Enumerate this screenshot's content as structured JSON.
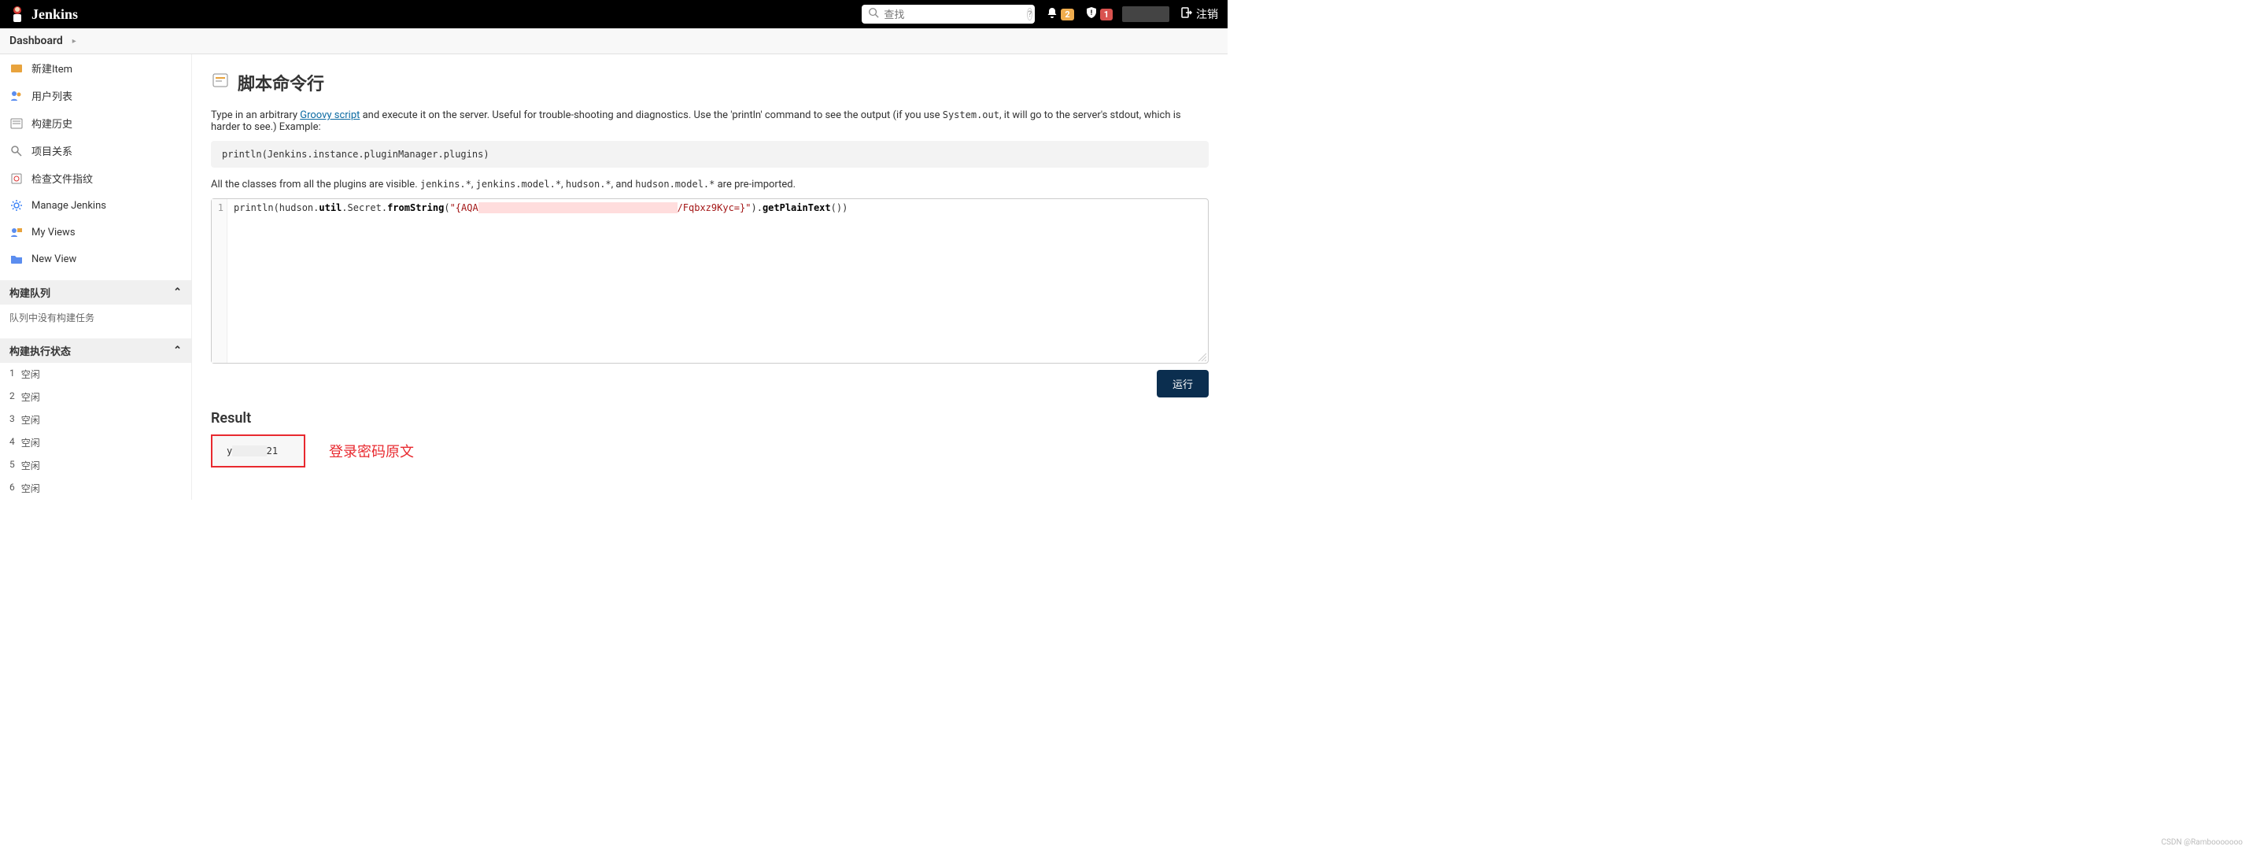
{
  "header": {
    "brand": "Jenkins",
    "search_placeholder": "查找",
    "notif_count": "2",
    "alert_count": "1",
    "logout_label": "注销"
  },
  "breadcrumb": {
    "root": "Dashboard"
  },
  "sidebar": {
    "items": [
      {
        "label": "新建Item"
      },
      {
        "label": "用户列表"
      },
      {
        "label": "构建历史"
      },
      {
        "label": "项目关系"
      },
      {
        "label": "检查文件指纹"
      },
      {
        "label": "Manage Jenkins"
      },
      {
        "label": "My Views"
      },
      {
        "label": "New View"
      }
    ],
    "queue_title": "构建队列",
    "queue_empty": "队列中没有构建任务",
    "exec_title": "构建执行状态",
    "executors": [
      {
        "n": "1",
        "state": "空闲"
      },
      {
        "n": "2",
        "state": "空闲"
      },
      {
        "n": "3",
        "state": "空闲"
      },
      {
        "n": "4",
        "state": "空闲"
      },
      {
        "n": "5",
        "state": "空闲"
      },
      {
        "n": "6",
        "state": "空闲"
      }
    ]
  },
  "page": {
    "title": "脚本命令行",
    "desc_pre": "Type in an arbitrary ",
    "desc_link": "Groovy script",
    "desc_mid": " and execute it on the server. Useful for trouble-shooting and diagnostics. Use the 'println' command to see the output (if you use ",
    "desc_code": "System.out",
    "desc_post": ", it will go to the server's stdout, which is harder to see.) Example:",
    "example_code": "println(Jenkins.instance.pluginManager.plugins)",
    "desc2_pre": "All the classes from all the plugins are visible. ",
    "desc2_c1": "jenkins.*",
    "desc2_s1": ", ",
    "desc2_c2": "jenkins.model.*",
    "desc2_s2": ", ",
    "desc2_c3": "hudson.*",
    "desc2_s3": ", and ",
    "desc2_c4": "hudson.model.*",
    "desc2_post": " are pre-imported.",
    "editor_line_no": "1",
    "editor_prefix": "println(hudson.",
    "editor_t1": "util",
    "editor_t2": ".Secret.",
    "editor_t3": "fromString",
    "editor_t4": "(",
    "editor_str_open": "\"{AQA",
    "editor_str_redacted": "                                   ",
    "editor_str_close": "/Fqbxz9Kyc=}\"",
    "editor_t5": ").",
    "editor_t6": "getPlainText",
    "editor_t7": "())",
    "run_label": "运行",
    "result_title": "Result",
    "result_prefix": "y",
    "result_suffix": "21",
    "annotation": "登录密码原文"
  },
  "watermark": "CSDN @Rambooooooo"
}
